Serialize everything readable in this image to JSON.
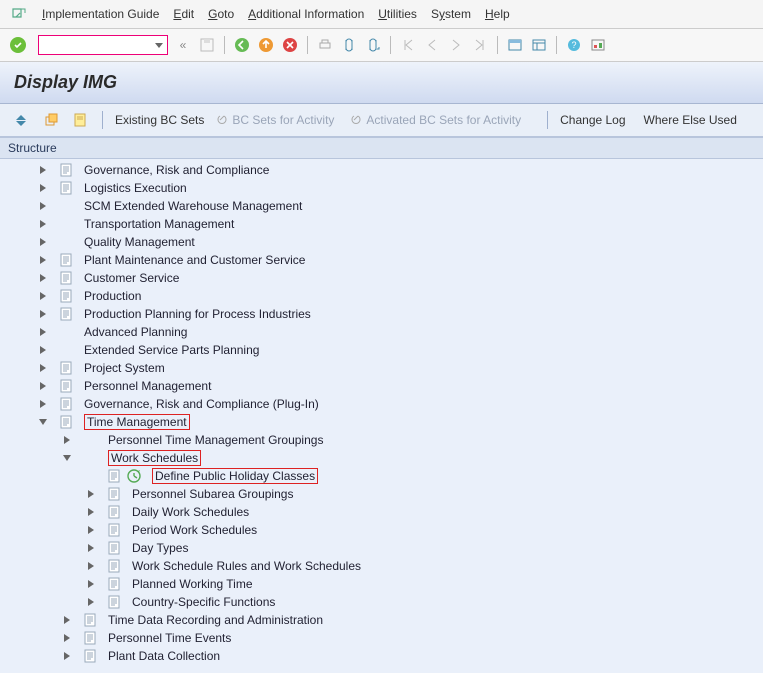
{
  "menu": {
    "guide": "Implementation Guide",
    "edit": "Edit",
    "goto": "Goto",
    "addl": "Additional Information",
    "util": "Utilities",
    "system": "System",
    "help": "Help"
  },
  "title": "Display IMG",
  "subtoolbar": {
    "existing": "Existing BC Sets",
    "activity": "BC Sets for Activity",
    "activated": "Activated BC Sets for Activity",
    "change": "Change Log",
    "where": "Where Else Used"
  },
  "structure_label": "Structure",
  "tree": [
    {
      "level": 1,
      "arrow": "r",
      "doc": true,
      "label": "Governance, Risk and Compliance"
    },
    {
      "level": 1,
      "arrow": "r",
      "doc": true,
      "label": "Logistics Execution"
    },
    {
      "level": 1,
      "arrow": "r",
      "doc": false,
      "label": "SCM Extended Warehouse Management"
    },
    {
      "level": 1,
      "arrow": "r",
      "doc": false,
      "label": "Transportation Management"
    },
    {
      "level": 1,
      "arrow": "r",
      "doc": false,
      "label": "Quality Management"
    },
    {
      "level": 1,
      "arrow": "r",
      "doc": true,
      "label": "Plant Maintenance and Customer Service"
    },
    {
      "level": 1,
      "arrow": "r",
      "doc": true,
      "label": "Customer Service"
    },
    {
      "level": 1,
      "arrow": "r",
      "doc": true,
      "label": "Production"
    },
    {
      "level": 1,
      "arrow": "r",
      "doc": true,
      "label": "Production Planning for Process Industries"
    },
    {
      "level": 1,
      "arrow": "r",
      "doc": false,
      "label": "Advanced Planning"
    },
    {
      "level": 1,
      "arrow": "r",
      "doc": false,
      "label": "Extended Service Parts Planning"
    },
    {
      "level": 1,
      "arrow": "r",
      "doc": true,
      "label": "Project System"
    },
    {
      "level": 1,
      "arrow": "r",
      "doc": true,
      "label": "Personnel Management"
    },
    {
      "level": 1,
      "arrow": "r",
      "doc": true,
      "label": "Governance, Risk and Compliance (Plug-In)"
    },
    {
      "level": 1,
      "arrow": "d",
      "doc": true,
      "label": "Time Management",
      "red": true
    },
    {
      "level": 2,
      "arrow": "r",
      "doc": false,
      "label": "Personnel Time Management Groupings"
    },
    {
      "level": 2,
      "arrow": "d",
      "doc": false,
      "label": "Work Schedules",
      "red": true
    },
    {
      "level": 3,
      "arrow": "",
      "doc": true,
      "exec": true,
      "label": "Define Public Holiday Classes",
      "red": true
    },
    {
      "level": 3,
      "arrow": "r",
      "doc": true,
      "label": "Personnel Subarea Groupings"
    },
    {
      "level": 3,
      "arrow": "r",
      "doc": true,
      "label": "Daily Work Schedules"
    },
    {
      "level": 3,
      "arrow": "r",
      "doc": true,
      "label": "Period Work Schedules"
    },
    {
      "level": 3,
      "arrow": "r",
      "doc": true,
      "label": "Day Types"
    },
    {
      "level": 3,
      "arrow": "r",
      "doc": true,
      "label": "Work Schedule Rules and Work Schedules"
    },
    {
      "level": 3,
      "arrow": "r",
      "doc": true,
      "label": "Planned Working Time"
    },
    {
      "level": 3,
      "arrow": "r",
      "doc": true,
      "label": "Country-Specific Functions"
    },
    {
      "level": 2,
      "arrow": "r",
      "doc": true,
      "label": "Time Data Recording and Administration"
    },
    {
      "level": 2,
      "arrow": "r",
      "doc": true,
      "label": "Personnel Time Events"
    },
    {
      "level": 2,
      "arrow": "r",
      "doc": true,
      "label": "Plant Data Collection"
    }
  ]
}
